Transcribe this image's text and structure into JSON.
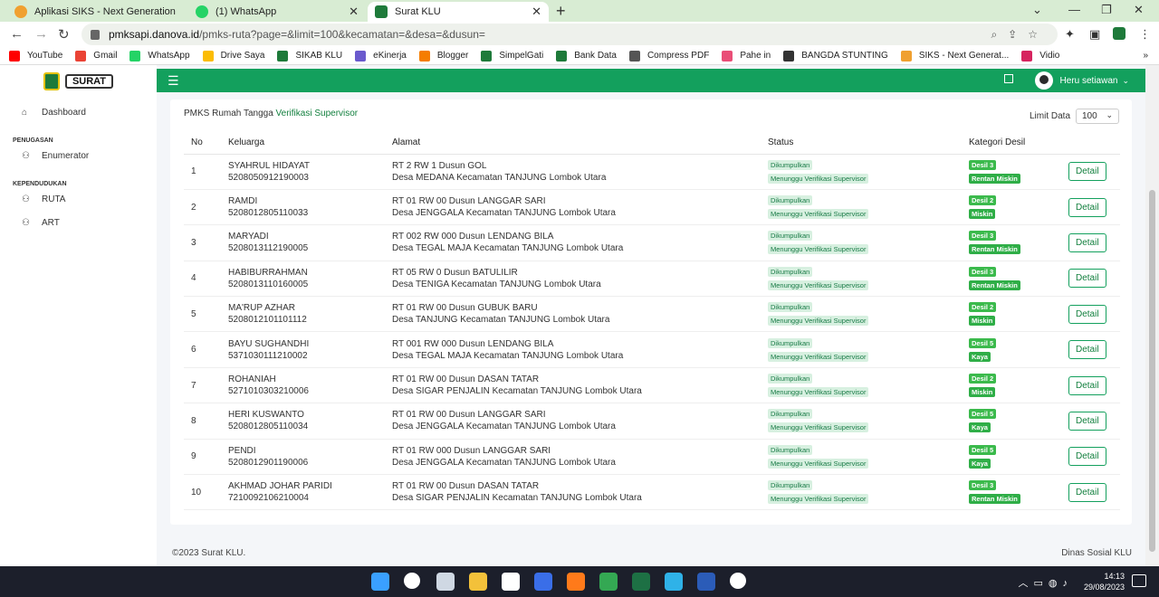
{
  "browser": {
    "tabs": [
      {
        "label": "Aplikasi SIKS - Next Generation",
        "color": "#f0a030"
      },
      {
        "label": "(1) WhatsApp",
        "color": "#25d366"
      },
      {
        "label": "Surat KLU",
        "color": "#1e7a3a"
      }
    ],
    "url_host": "pmksapi.danova.id",
    "url_path": "/pmks-ruta?page=&limit=100&kecamatan=&desa=&dusun=",
    "bookmarks": [
      {
        "label": "YouTube",
        "color": "#ff0000"
      },
      {
        "label": "Gmail",
        "color": "#ea4335"
      },
      {
        "label": "WhatsApp",
        "color": "#25d366"
      },
      {
        "label": "Drive Saya",
        "color": "#fbbc04"
      },
      {
        "label": "SIKAB KLU",
        "color": "#1e7a3a"
      },
      {
        "label": "eKinerja",
        "color": "#6a5acd"
      },
      {
        "label": "Blogger",
        "color": "#f57d00"
      },
      {
        "label": "SimpelGati",
        "color": "#1e7a3a"
      },
      {
        "label": "Bank Data",
        "color": "#1e7a3a"
      },
      {
        "label": "Compress PDF",
        "color": "#555555"
      },
      {
        "label": "Pahe in",
        "color": "#e94e77"
      },
      {
        "label": "BANGDA STUNTING",
        "color": "#333333"
      },
      {
        "label": "SIKS - Next Generat...",
        "color": "#f0a030"
      },
      {
        "label": "Vidio",
        "color": "#d6245f"
      }
    ]
  },
  "app": {
    "logo_text": "SURAT",
    "sidebar": {
      "items": [
        {
          "type": "item",
          "label": "Dashboard",
          "icon": "home-icon",
          "glyph": "⌂"
        },
        {
          "type": "section",
          "label": "PENUGASAN"
        },
        {
          "type": "item",
          "label": "Enumerator",
          "icon": "users-icon",
          "glyph": "⚇"
        },
        {
          "type": "section",
          "label": "KEPENDUDUKAN"
        },
        {
          "type": "item",
          "label": "RUTA",
          "icon": "user-icon",
          "glyph": "⚇"
        },
        {
          "type": "item",
          "label": "ART",
          "icon": "users-icon",
          "glyph": "⚇"
        }
      ]
    },
    "user_name": "Heru setiawan",
    "card": {
      "title_prefix": "PMKS Rumah Tangga",
      "title_accent": "Verifikasi Supervisor",
      "limit_label": "Limit Data",
      "limit_value": "100"
    },
    "table": {
      "headers": [
        "No",
        "Keluarga",
        "Alamat",
        "Status",
        "Kategori Desil",
        ""
      ],
      "rows": [
        {
          "no": "1",
          "name": "SYAHRUL HIDAYAT",
          "nik": "5208050912190003",
          "addr1": "RT 2 RW 1 Dusun GOL",
          "addr2": "Desa MEDANA Kecamatan TANJUNG Lombok Utara",
          "desil": "Desil 3",
          "kat": "Rentan Miskin"
        },
        {
          "no": "2",
          "name": "RAMDI",
          "nik": "5208012805110033",
          "addr1": "RT 01 RW 00 Dusun LANGGAR SARI",
          "addr2": "Desa JENGGALA Kecamatan TANJUNG Lombok Utara",
          "desil": "Desil 2",
          "kat": "Miskin"
        },
        {
          "no": "3",
          "name": "MARYADI",
          "nik": "5208013112190005",
          "addr1": "RT 002 RW 000 Dusun LENDANG BILA",
          "addr2": "Desa TEGAL MAJA Kecamatan TANJUNG Lombok Utara",
          "desil": "Desil 3",
          "kat": "Rentan Miskin"
        },
        {
          "no": "4",
          "name": "HABIBURRAHMAN",
          "nik": "5208013110160005",
          "addr1": "RT 05 RW 0 Dusun BATULILIR",
          "addr2": "Desa TENIGA Kecamatan TANJUNG Lombok Utara",
          "desil": "Desil 3",
          "kat": "Rentan Miskin"
        },
        {
          "no": "5",
          "name": "MA'RUP AZHAR",
          "nik": "5208012101101112",
          "addr1": "RT 01 RW 00 Dusun GUBUK BARU",
          "addr2": "Desa TANJUNG Kecamatan TANJUNG Lombok Utara",
          "desil": "Desil 2",
          "kat": "Miskin"
        },
        {
          "no": "6",
          "name": "BAYU SUGHANDHI",
          "nik": "5371030111210002",
          "addr1": "RT 001 RW 000 Dusun LENDANG BILA",
          "addr2": "Desa TEGAL MAJA Kecamatan TANJUNG Lombok Utara",
          "desil": "Desil 5",
          "kat": "Kaya"
        },
        {
          "no": "7",
          "name": "ROHANIAH",
          "nik": "5271010303210006",
          "addr1": "RT 01 RW 00 Dusun DASAN TATAR",
          "addr2": "Desa SIGAR PENJALIN Kecamatan TANJUNG Lombok Utara",
          "desil": "Desil 2",
          "kat": "Miskin"
        },
        {
          "no": "8",
          "name": "HERI KUSWANTO",
          "nik": "5208012805110034",
          "addr1": "RT 01 RW 00 Dusun LANGGAR SARI",
          "addr2": "Desa JENGGALA Kecamatan TANJUNG Lombok Utara",
          "desil": "Desil 5",
          "kat": "Kaya"
        },
        {
          "no": "9",
          "name": "PENDI",
          "nik": "5208012901190006",
          "addr1": "RT 01 RW 000 Dusun LANGGAR SARI",
          "addr2": "Desa JENGGALA Kecamatan TANJUNG Lombok Utara",
          "desil": "Desil 5",
          "kat": "Kaya"
        },
        {
          "no": "10",
          "name": "AKHMAD JOHAR PARIDI",
          "nik": "7210092106210004",
          "addr1": "RT 01 RW 00 Dusun DASAN TATAR",
          "addr2": "Desa SIGAR PENJALIN Kecamatan TANJUNG Lombok Utara",
          "desil": "Desil 3",
          "kat": "Rentan Miskin"
        }
      ],
      "status_collected": "Dikumpulkan",
      "status_waiting": "Menunggu Verifikasi Supervisor",
      "detail_label": "Detail"
    },
    "footer_left": "©2023 Surat KLU.",
    "footer_right": "Dinas Sosial KLU"
  },
  "taskbar": {
    "time": "14:13",
    "date": "29/08/2023",
    "icons": [
      {
        "name": "windows-start-icon",
        "color": "#3aa0ff"
      },
      {
        "name": "search-icon",
        "color": "#ffffff"
      },
      {
        "name": "task-view-icon",
        "color": "#cfd8e3"
      },
      {
        "name": "file-explorer-icon",
        "color": "#f3c13a"
      },
      {
        "name": "store-icon",
        "color": "#ffffff"
      },
      {
        "name": "app-icon",
        "color": "#3a6ee8"
      },
      {
        "name": "firefox-icon",
        "color": "#ff7a1a"
      },
      {
        "name": "chrome-icon",
        "color": "#34a853"
      },
      {
        "name": "excel-icon",
        "color": "#1d7044"
      },
      {
        "name": "edge-icon",
        "color": "#2fb2e8"
      },
      {
        "name": "word-icon",
        "color": "#2b5cb8"
      },
      {
        "name": "chat-icon",
        "color": "#ffffff"
      }
    ]
  }
}
